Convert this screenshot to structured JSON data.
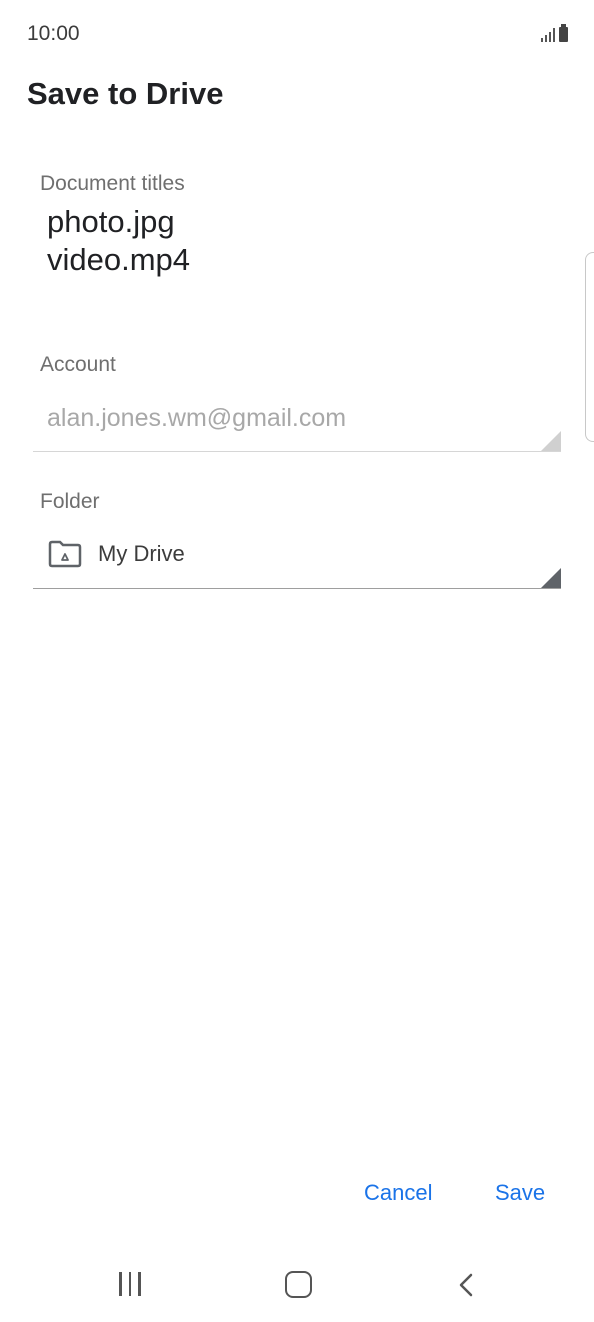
{
  "status_bar": {
    "time": "10:00"
  },
  "page_title": "Save to Drive",
  "document": {
    "label": "Document titles",
    "titles": [
      "photo.jpg",
      "video.mp4"
    ]
  },
  "account": {
    "label": "Account",
    "value": "alan.jones.wm@gmail.com"
  },
  "folder": {
    "label": "Folder",
    "value": "My Drive",
    "icon": "drive-folder-icon"
  },
  "actions": {
    "cancel_label": "Cancel",
    "save_label": "Save"
  },
  "colors": {
    "accent": "#1a73e8",
    "text": "#202124",
    "muted": "#6f6f6f",
    "disabled": "#a8a8a8"
  }
}
